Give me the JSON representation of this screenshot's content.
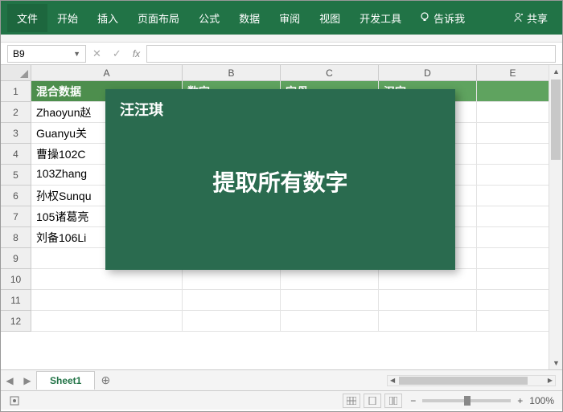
{
  "ribbon": {
    "file": "文件",
    "tabs": [
      "开始",
      "插入",
      "页面布局",
      "公式",
      "数据",
      "审阅",
      "视图",
      "开发工具"
    ],
    "tellme": "告诉我",
    "share": "共享"
  },
  "nameBox": "B9",
  "cols": [
    "A",
    "B",
    "C",
    "D",
    "E"
  ],
  "rowCount": 12,
  "headerRow": {
    "A": "混合数据",
    "B": "数字",
    "C": "字母",
    "D": "汉字"
  },
  "dataA": [
    "Zhaoyun赵",
    "Guanyu关",
    "曹操102C",
    "103Zhang",
    "孙权Sunqu",
    "105诸葛亮",
    "刘备106Li"
  ],
  "overlay": {
    "author": "汪汪琪",
    "title": "提取所有数字"
  },
  "sheetTab": "Sheet1",
  "zoom": "100%"
}
